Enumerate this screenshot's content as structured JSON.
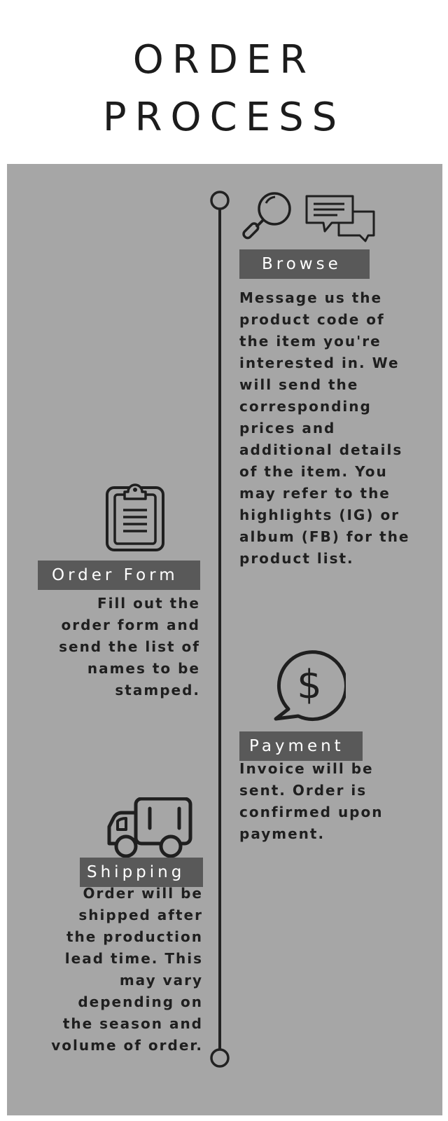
{
  "title": {
    "line1": "ORDER",
    "line2": "PROCESS"
  },
  "steps": {
    "browse": {
      "label": "Browse",
      "lines": [
        "Message us the",
        "product code of",
        "the item you're",
        "interested in. We",
        "will send the",
        "corresponding",
        "prices and",
        "additional details",
        "of the item. You",
        "may refer to the",
        "highlights (IG) or",
        "album (FB) for the",
        "product list."
      ],
      "icons": [
        "magnifying-glass-icon",
        "chat-bubbles-icon"
      ]
    },
    "order_form": {
      "label": "Order Form",
      "lines": [
        "Fill out the",
        "order form and",
        "send the list of",
        "names to be",
        "stamped."
      ],
      "icons": [
        "clipboard-icon"
      ]
    },
    "payment": {
      "label": "Payment",
      "lines": [
        "Invoice will be",
        "sent. Order is",
        "confirmed upon",
        "payment."
      ],
      "icons": [
        "dollar-speech-bubble-icon"
      ]
    },
    "shipping": {
      "label": "Shipping",
      "lines": [
        "Order will be",
        "shipped after",
        "the production",
        "lead time. This",
        "may vary",
        "depending on",
        "the season and",
        "volume of order."
      ],
      "icons": [
        "delivery-truck-icon"
      ]
    }
  },
  "colors": {
    "panel_background": "#a6a6a6",
    "label_background": "#595959",
    "label_text": "#ffffff",
    "text": "#1f1f1f"
  }
}
